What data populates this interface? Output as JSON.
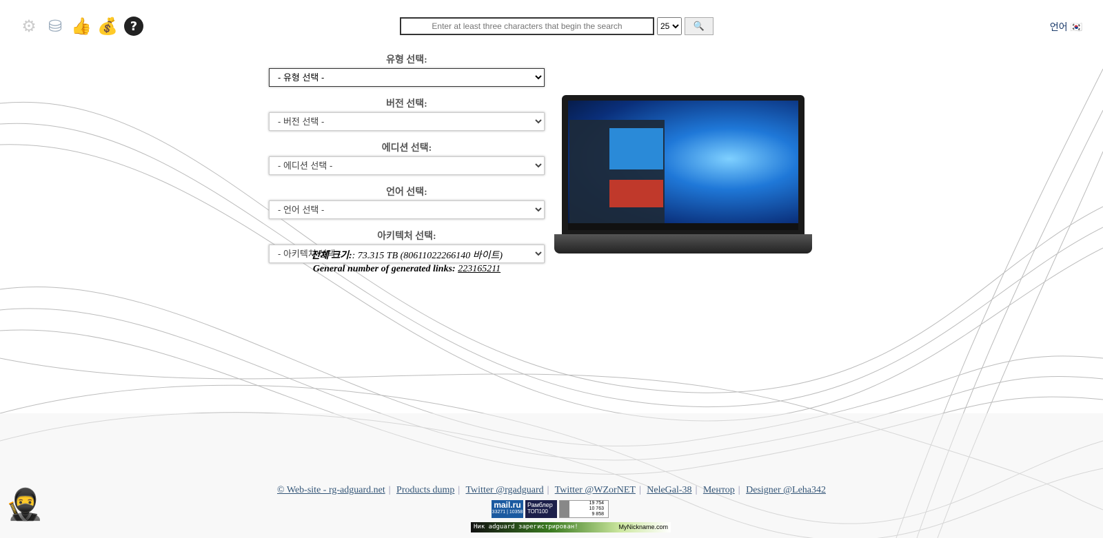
{
  "header": {
    "icons": [
      "gear-icon",
      "database-icon",
      "thumbs-up-icon",
      "money-bag-icon",
      "help-icon"
    ],
    "search_placeholder": "Enter at least three characters that begin the search",
    "count": "25",
    "search_icon": "🔍",
    "lang": "언어"
  },
  "form": {
    "fields": [
      {
        "label": "유형 선택:",
        "value": "- 유형 선택 -"
      },
      {
        "label": "버전 선택:",
        "value": "- 버전 선택 -"
      },
      {
        "label": "에디션 선택:",
        "value": "- 에디션 선택 -"
      },
      {
        "label": "언어 선택:",
        "value": "- 언어 선택 -"
      },
      {
        "label": "아키텍처 선택:",
        "value": "- 아키텍처 선택 -"
      }
    ]
  },
  "stats": {
    "size_label": "전체 크기:",
    "size_value": ": 73.315 TB (80611022266140 바이트)",
    "links_label": "General number of generated links:",
    "links_value": "223165211"
  },
  "footer": {
    "links": [
      "© Web-site - rg-adguard.net",
      "Products dump",
      "Twitter @rgadguard",
      "Twitter @WZorNET",
      "NeleGal-38",
      "Ментор",
      "Designer @Leha342"
    ]
  },
  "badges": {
    "mail_logo": "mail.ru",
    "mail_a": "33271",
    "mail_b": "10358",
    "rambler": "Рамблер",
    "rambler_sub": "ТОП100",
    "li_1": "19 754",
    "li_2": "10 763",
    "li_3": "9 858",
    "nick_text": "Ник adguard зарегистрирован!",
    "nick_site": "MyNickname.com"
  }
}
